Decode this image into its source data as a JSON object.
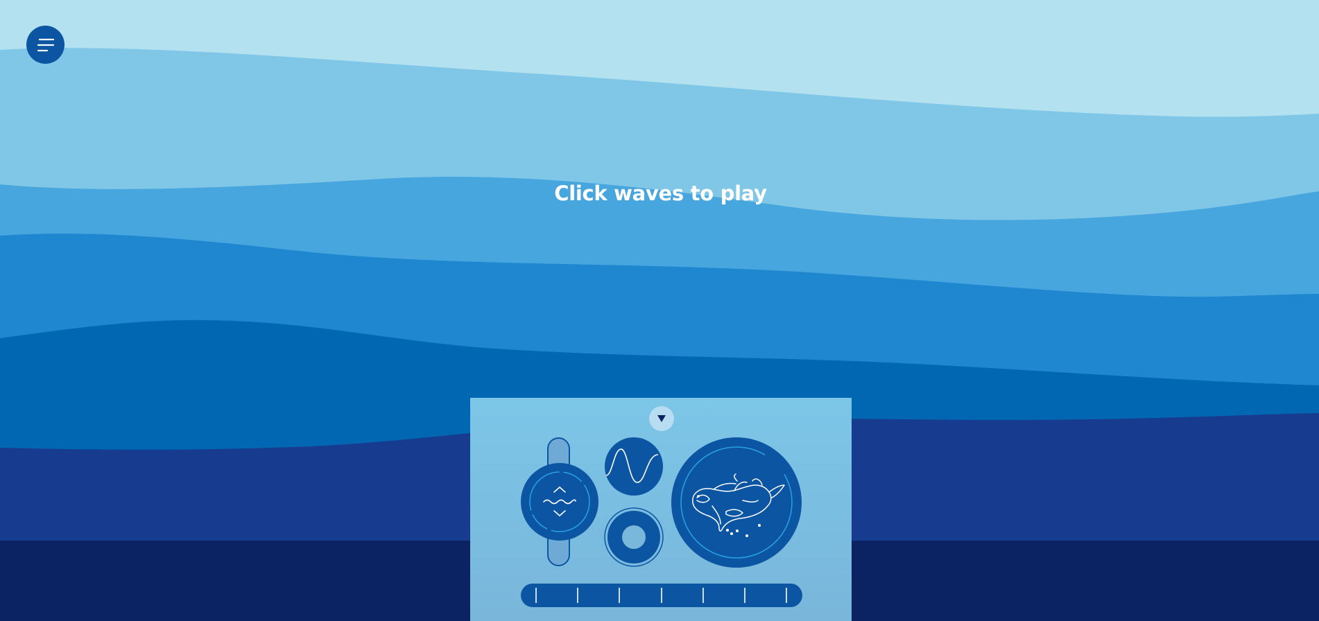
{
  "headline": "Click waves to play",
  "colors": {
    "sky": "#b3e1f0",
    "wave_1": "#80c7e7",
    "wave_2": "#48a6df",
    "wave_3": "#1e87cf",
    "wave_4": "#0267b3",
    "wave_5": "#163b8f",
    "wave_6": "#0b2263",
    "control_blue": "#0b55a3",
    "panel": "#7cc6e8"
  },
  "menu": {
    "icon": "hamburger-menu-icon"
  },
  "panel": {
    "collapse_icon": "triangle-down-icon",
    "controls": [
      {
        "name": "wave-height-knob",
        "icon": "wave-chevrons-icon"
      },
      {
        "name": "wave-shape-button",
        "icon": "sine-wave-icon"
      },
      {
        "name": "ring-knob",
        "icon": "ring-icon"
      },
      {
        "name": "creature-button",
        "icon": "orca-icon"
      }
    ],
    "timeline_ticks": 7
  }
}
